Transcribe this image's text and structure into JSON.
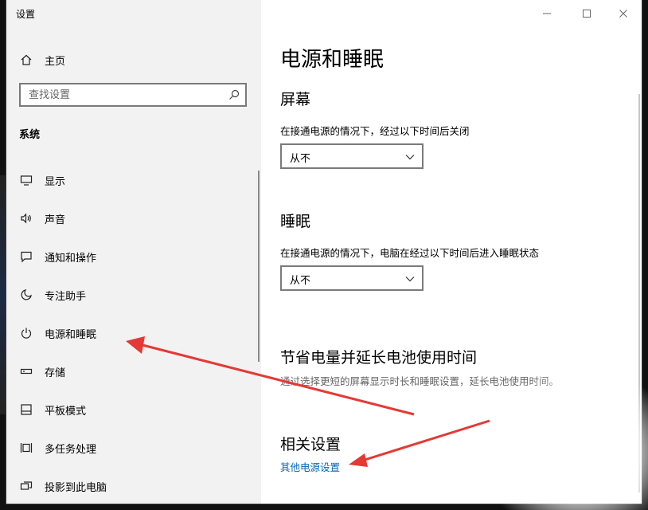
{
  "window": {
    "title": "设置"
  },
  "sidebar": {
    "home_label": "主页",
    "search_placeholder": "查找设置",
    "section_label": "系统",
    "items": [
      {
        "label": "显示",
        "icon": "monitor-icon"
      },
      {
        "label": "声音",
        "icon": "speaker-icon"
      },
      {
        "label": "通知和操作",
        "icon": "notification-icon"
      },
      {
        "label": "专注助手",
        "icon": "moon-icon"
      },
      {
        "label": "电源和睡眠",
        "icon": "power-icon",
        "active": true
      },
      {
        "label": "存储",
        "icon": "storage-icon"
      },
      {
        "label": "平板模式",
        "icon": "tablet-icon"
      },
      {
        "label": "多任务处理",
        "icon": "multitask-icon"
      },
      {
        "label": "投影到此电脑",
        "icon": "project-icon"
      }
    ]
  },
  "content": {
    "page_title": "电源和睡眠",
    "screen": {
      "heading": "屏幕",
      "description": "在接通电源的情况下，经过以下时间后关闭",
      "value": "从不"
    },
    "sleep": {
      "heading": "睡眠",
      "description": "在接通电源的情况下，电脑在经过以下时间后进入睡眠状态",
      "value": "从不"
    },
    "battery": {
      "heading": "节省电量并延长电池使用时间",
      "description": "通过选择更短的屏幕显示时长和睡眠设置，延长电池使用时间。"
    },
    "related": {
      "heading": "相关设置",
      "link": "其他电源设置"
    }
  },
  "colors": {
    "accent_link": "#0067b8",
    "sidebar_bg": "#f2f2f2",
    "annotation_arrow": "#e53935"
  }
}
